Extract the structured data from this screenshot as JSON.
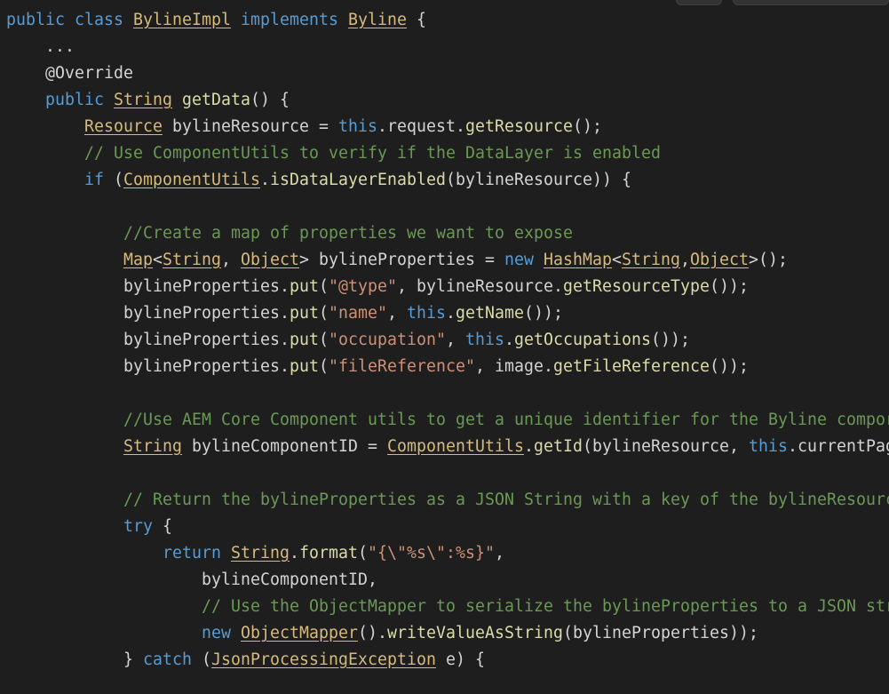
{
  "code_viewer": {
    "lines": [
      {
        "indent": "",
        "tokens": [
          {
            "t": "public ",
            "c": "kw"
          },
          {
            "t": "class ",
            "c": "kw"
          },
          {
            "t": "BylineImpl",
            "c": "tyu"
          },
          {
            "t": " ",
            "c": "plain"
          },
          {
            "t": "implements ",
            "c": "kw"
          },
          {
            "t": "Byline",
            "c": "tyu"
          },
          {
            "t": " {",
            "c": "plain"
          }
        ]
      },
      {
        "indent": "    ",
        "tokens": [
          {
            "t": "...",
            "c": "plain"
          }
        ]
      },
      {
        "indent": "    ",
        "tokens": [
          {
            "t": "@Override",
            "c": "ann"
          }
        ]
      },
      {
        "indent": "    ",
        "tokens": [
          {
            "t": "public ",
            "c": "kw"
          },
          {
            "t": "String",
            "c": "tyu"
          },
          {
            "t": " ",
            "c": "plain"
          },
          {
            "t": "getData",
            "c": "fn"
          },
          {
            "t": "() {",
            "c": "plain"
          }
        ]
      },
      {
        "indent": "        ",
        "tokens": [
          {
            "t": "Resource",
            "c": "tyu"
          },
          {
            "t": " bylineResource = ",
            "c": "plain"
          },
          {
            "t": "this",
            "c": "kw"
          },
          {
            "t": ".request.",
            "c": "plain"
          },
          {
            "t": "getResource",
            "c": "fn"
          },
          {
            "t": "();",
            "c": "plain"
          }
        ]
      },
      {
        "indent": "        ",
        "tokens": [
          {
            "t": "// Use ComponentUtils to verify if the DataLayer is enabled",
            "c": "com"
          }
        ]
      },
      {
        "indent": "        ",
        "tokens": [
          {
            "t": "if ",
            "c": "kw"
          },
          {
            "t": "(",
            "c": "plain"
          },
          {
            "t": "ComponentUtils",
            "c": "tyu"
          },
          {
            "t": ".",
            "c": "plain"
          },
          {
            "t": "isDataLayerEnabled",
            "c": "fn"
          },
          {
            "t": "(bylineResource)) {",
            "c": "plain"
          }
        ]
      },
      {
        "indent": "",
        "tokens": [
          {
            "t": "",
            "c": "plain"
          }
        ]
      },
      {
        "indent": "            ",
        "tokens": [
          {
            "t": "//Create a map of properties we want to expose",
            "c": "com"
          }
        ]
      },
      {
        "indent": "            ",
        "tokens": [
          {
            "t": "Map",
            "c": "tyu"
          },
          {
            "t": "<",
            "c": "plain"
          },
          {
            "t": "String",
            "c": "tyu"
          },
          {
            "t": ", ",
            "c": "plain"
          },
          {
            "t": "Object",
            "c": "tyu"
          },
          {
            "t": "> bylineProperties = ",
            "c": "plain"
          },
          {
            "t": "new ",
            "c": "kw"
          },
          {
            "t": "HashMap",
            "c": "tyu"
          },
          {
            "t": "<",
            "c": "plain"
          },
          {
            "t": "String",
            "c": "tyu"
          },
          {
            "t": ",",
            "c": "plain"
          },
          {
            "t": "Object",
            "c": "tyu"
          },
          {
            "t": ">();",
            "c": "plain"
          }
        ]
      },
      {
        "indent": "            ",
        "tokens": [
          {
            "t": "bylineProperties.",
            "c": "plain"
          },
          {
            "t": "put",
            "c": "fn"
          },
          {
            "t": "(",
            "c": "plain"
          },
          {
            "t": "\"@type\"",
            "c": "str"
          },
          {
            "t": ", bylineResource.",
            "c": "plain"
          },
          {
            "t": "getResourceType",
            "c": "fn"
          },
          {
            "t": "());",
            "c": "plain"
          }
        ]
      },
      {
        "indent": "            ",
        "tokens": [
          {
            "t": "bylineProperties.",
            "c": "plain"
          },
          {
            "t": "put",
            "c": "fn"
          },
          {
            "t": "(",
            "c": "plain"
          },
          {
            "t": "\"name\"",
            "c": "str"
          },
          {
            "t": ", ",
            "c": "plain"
          },
          {
            "t": "this",
            "c": "kw"
          },
          {
            "t": ".",
            "c": "plain"
          },
          {
            "t": "getName",
            "c": "fn"
          },
          {
            "t": "());",
            "c": "plain"
          }
        ]
      },
      {
        "indent": "            ",
        "tokens": [
          {
            "t": "bylineProperties.",
            "c": "plain"
          },
          {
            "t": "put",
            "c": "fn"
          },
          {
            "t": "(",
            "c": "plain"
          },
          {
            "t": "\"occupation\"",
            "c": "str"
          },
          {
            "t": ", ",
            "c": "plain"
          },
          {
            "t": "this",
            "c": "kw"
          },
          {
            "t": ".",
            "c": "plain"
          },
          {
            "t": "getOccupations",
            "c": "fn"
          },
          {
            "t": "());",
            "c": "plain"
          }
        ]
      },
      {
        "indent": "            ",
        "tokens": [
          {
            "t": "bylineProperties.",
            "c": "plain"
          },
          {
            "t": "put",
            "c": "fn"
          },
          {
            "t": "(",
            "c": "plain"
          },
          {
            "t": "\"fileReference\"",
            "c": "str"
          },
          {
            "t": ", image.",
            "c": "plain"
          },
          {
            "t": "getFileReference",
            "c": "fn"
          },
          {
            "t": "());",
            "c": "plain"
          }
        ]
      },
      {
        "indent": "",
        "tokens": [
          {
            "t": "",
            "c": "plain"
          }
        ]
      },
      {
        "indent": "            ",
        "tokens": [
          {
            "t": "//Use AEM Core Component utils to get a unique identifier for the Byline compor",
            "c": "com"
          }
        ]
      },
      {
        "indent": "            ",
        "tokens": [
          {
            "t": "String",
            "c": "tyu"
          },
          {
            "t": " bylineComponentID = ",
            "c": "plain"
          },
          {
            "t": "ComponentUtils",
            "c": "tyu"
          },
          {
            "t": ".",
            "c": "plain"
          },
          {
            "t": "getId",
            "c": "fn"
          },
          {
            "t": "(bylineResource, ",
            "c": "plain"
          },
          {
            "t": "this",
            "c": "kw"
          },
          {
            "t": ".currentPag",
            "c": "plain"
          }
        ]
      },
      {
        "indent": "",
        "tokens": [
          {
            "t": "",
            "c": "plain"
          }
        ]
      },
      {
        "indent": "            ",
        "tokens": [
          {
            "t": "// Return the bylineProperties as a JSON String with a key of the bylineResourc",
            "c": "com"
          }
        ]
      },
      {
        "indent": "            ",
        "tokens": [
          {
            "t": "try",
            "c": "kw"
          },
          {
            "t": " {",
            "c": "plain"
          }
        ]
      },
      {
        "indent": "                ",
        "tokens": [
          {
            "t": "return ",
            "c": "kw"
          },
          {
            "t": "String",
            "c": "tyu"
          },
          {
            "t": ".",
            "c": "plain"
          },
          {
            "t": "format",
            "c": "fn"
          },
          {
            "t": "(",
            "c": "plain"
          },
          {
            "t": "\"{\\\"%s\\\":%s}\"",
            "c": "str"
          },
          {
            "t": ",",
            "c": "plain"
          }
        ]
      },
      {
        "indent": "                    ",
        "tokens": [
          {
            "t": "bylineComponentID,",
            "c": "plain"
          }
        ]
      },
      {
        "indent": "                    ",
        "tokens": [
          {
            "t": "// Use the ObjectMapper to serialize the bylineProperties to a JSON str",
            "c": "com"
          }
        ]
      },
      {
        "indent": "                    ",
        "tokens": [
          {
            "t": "new ",
            "c": "kw"
          },
          {
            "t": "ObjectMapper",
            "c": "tyu"
          },
          {
            "t": "().",
            "c": "plain"
          },
          {
            "t": "writeValueAsString",
            "c": "fn"
          },
          {
            "t": "(bylineProperties));",
            "c": "plain"
          }
        ]
      },
      {
        "indent": "            ",
        "tokens": [
          {
            "t": "} ",
            "c": "plain"
          },
          {
            "t": "catch",
            "c": "kw"
          },
          {
            "t": " (",
            "c": "plain"
          },
          {
            "t": "JsonProcessingException",
            "c": "tyu"
          },
          {
            "t": " e) {",
            "c": "plain"
          }
        ]
      }
    ]
  }
}
